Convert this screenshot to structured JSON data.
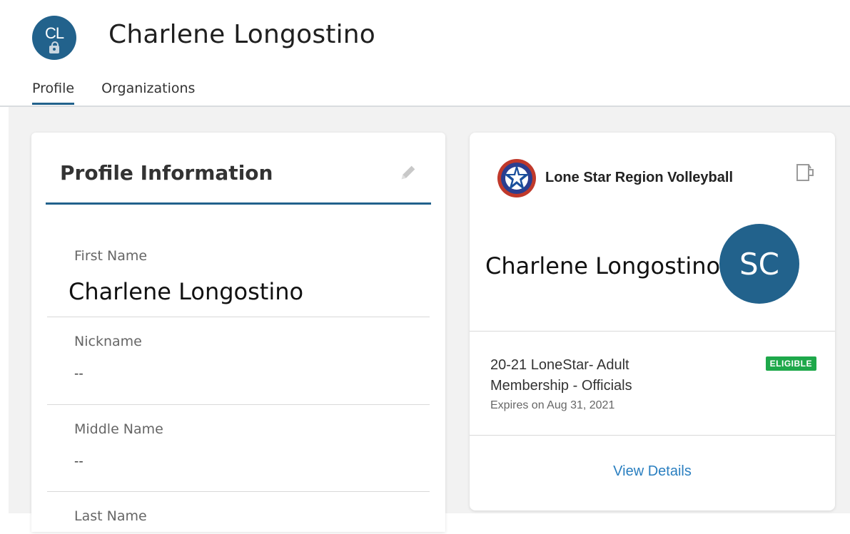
{
  "header": {
    "avatar_initials": "CL",
    "title": "Charlene Longostino",
    "tabs": [
      {
        "label": "Profile",
        "active": true
      },
      {
        "label": "Organizations",
        "active": false
      }
    ]
  },
  "profile_card": {
    "title": "Profile Information",
    "edit_icon": "pencil-icon",
    "fields": [
      {
        "label": "First Name",
        "value": "Charlene Longostino"
      },
      {
        "label": "Nickname",
        "value": "--"
      },
      {
        "label": "Middle Name",
        "value": "--"
      },
      {
        "label": "Last Name",
        "value": ""
      }
    ]
  },
  "membership_card": {
    "org_name": "Lone Star Region Volleyball",
    "wallet_icon": "wallet-icon",
    "member_name": "Charlene Longostino",
    "avatar_initials": "SC",
    "membership_title": "20-21 LoneStar- Adult Membership - Officials",
    "status_badge": "ELIGIBLE",
    "expires": "Expires on Aug 31, 2021",
    "action_label": "View Details"
  },
  "colors": {
    "primary": "#22628c",
    "link": "#2a7fc0",
    "eligible": "#1ea84a",
    "background": "#f2f2f2"
  }
}
